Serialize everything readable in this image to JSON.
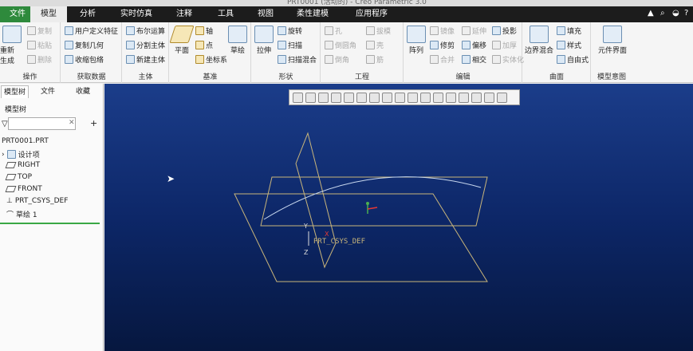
{
  "window": {
    "title": "PRT0001 (活动的) - Creo Parametric 3.0"
  },
  "tabs": [
    {
      "label": "文件"
    },
    {
      "label": "模型"
    },
    {
      "label": "分析"
    },
    {
      "label": "实时仿真"
    },
    {
      "label": "注释"
    },
    {
      "label": "工具"
    },
    {
      "label": "视图"
    },
    {
      "label": "柔性建模"
    },
    {
      "label": "应用程序"
    }
  ],
  "ribbon": {
    "operations": {
      "label": "操作",
      "regen": "重新生成",
      "copy": "复制",
      "paste": "粘贴",
      "delete": "删除"
    },
    "getdata": {
      "label": "获取数据",
      "udf": "用户定义特征",
      "copygeom": "复制几何",
      "shrinkwrap": "收缩包络"
    },
    "body": {
      "label": "主体",
      "boolean": "布尔运算",
      "split": "分割主体",
      "newbody": "新建主体"
    },
    "datum": {
      "label": "基准",
      "plane": "平面",
      "axis": "轴",
      "point": "点",
      "csys": "坐标系",
      "sketch": "草绘"
    },
    "shapes": {
      "label": "形状",
      "extrude": "拉伸",
      "revolve": "旋转",
      "sweep": "扫描",
      "sweptblend": "扫描混合"
    },
    "engineering": {
      "label": "工程",
      "hole": "孔",
      "round": "倒圆角",
      "chamfer": "倒角",
      "draft": "拔模",
      "shell": "壳",
      "rib": "筋"
    },
    "editing": {
      "label": "编辑",
      "pattern": "阵列",
      "mirror": "镜像",
      "trim": "修剪",
      "merge": "合并",
      "extend": "延伸",
      "offset": "偏移",
      "intersect": "相交",
      "project": "投影",
      "thicken": "加厚",
      "solidify": "实体化"
    },
    "surfaces": {
      "label": "曲面",
      "boundary": "边界混合",
      "fill": "填充",
      "style": "样式",
      "freestyle": "自由式"
    },
    "modelintent": {
      "label": "模型意图",
      "component": "元件界面"
    }
  },
  "left": {
    "tabs": [
      "模型树",
      "文件",
      "收藏"
    ],
    "toolbar_label": "模型树",
    "tree": [
      "PRT0001.PRT",
      "设计项",
      "RIGHT",
      "TOP",
      "FRONT",
      "PRT_CSYS_DEF",
      "草绘 1"
    ]
  },
  "viewport": {
    "csys_label": "PRT_CSYS_DEF",
    "axes": [
      "Y",
      "X",
      "Z"
    ]
  }
}
